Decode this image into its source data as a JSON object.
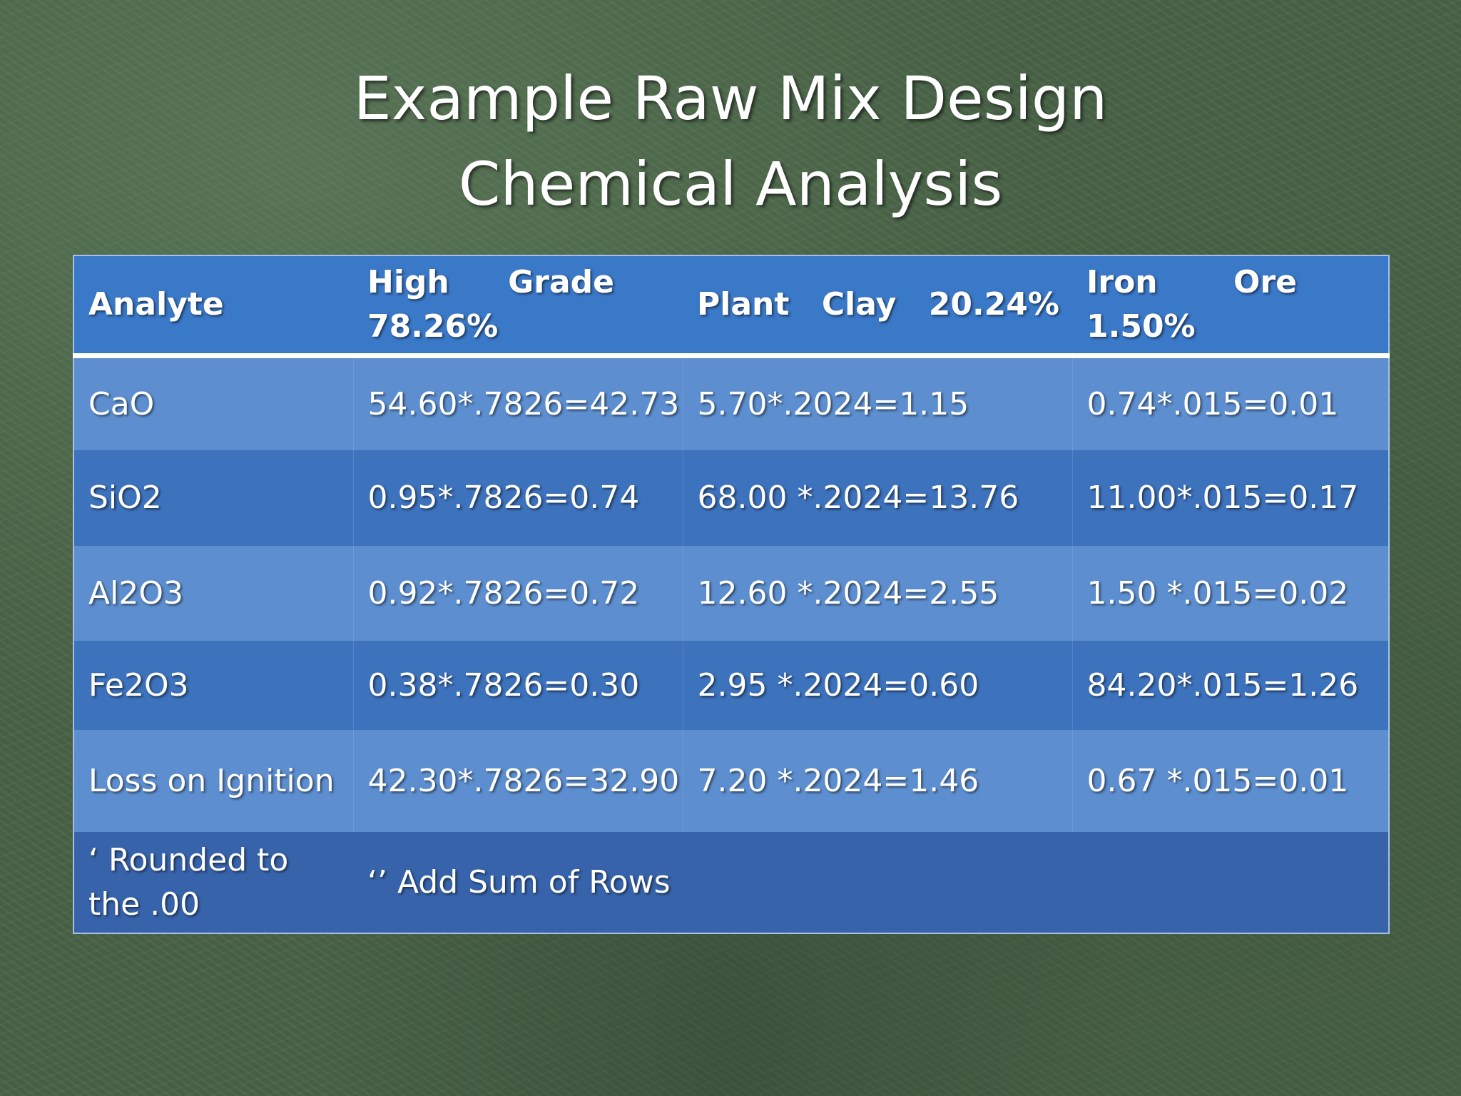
{
  "title": {
    "line1": "Example Raw Mix Design",
    "line2": "Chemical Analysis"
  },
  "table": {
    "headers": {
      "analyte": "Analyte",
      "col1": {
        "w1": "High",
        "w2": "Grade",
        "line2": "78.26%"
      },
      "col2": {
        "w1": "Plant",
        "w2": "Clay",
        "w3": "20.24%"
      },
      "col3": {
        "w1": "Iron",
        "w2": "Ore",
        "line2": "1.50%"
      }
    },
    "rows": [
      {
        "analyte": "CaO",
        "high_grade": "54.60*.7826=42.73",
        "plant_clay": "5.70*.2024=1.15",
        "iron_ore": "0.74*.015=0.01"
      },
      {
        "analyte": "SiO2",
        "high_grade": "0.95*.7826=0.74",
        "plant_clay": "68.00 *.2024=13.76",
        "iron_ore": "11.00*.015=0.17"
      },
      {
        "analyte": "Al2O3",
        "high_grade": "0.92*.7826=0.72",
        "plant_clay": "12.60 *.2024=2.55",
        "iron_ore": "1.50 *.015=0.02"
      },
      {
        "analyte": "Fe2O3",
        "high_grade": "0.38*.7826=0.30",
        "plant_clay": "2.95 *.2024=0.60",
        "iron_ore": "84.20*.015=1.26"
      },
      {
        "analyte": "Loss on Ignition",
        "high_grade": "42.30*.7826=32.90",
        "plant_clay": "7.20 *.2024=1.46",
        "iron_ore": "0.67 *.015=0.01"
      }
    ],
    "footer": {
      "note1": "‘ Rounded to the .00",
      "note2": "‘’ Add Sum of Rows"
    }
  },
  "colors": {
    "background": "#4a6448",
    "header_row": "#3a78c8",
    "row_light": "#5d8fd0",
    "row_dark": "#3d72bd",
    "footer_row": "#3763ab"
  }
}
